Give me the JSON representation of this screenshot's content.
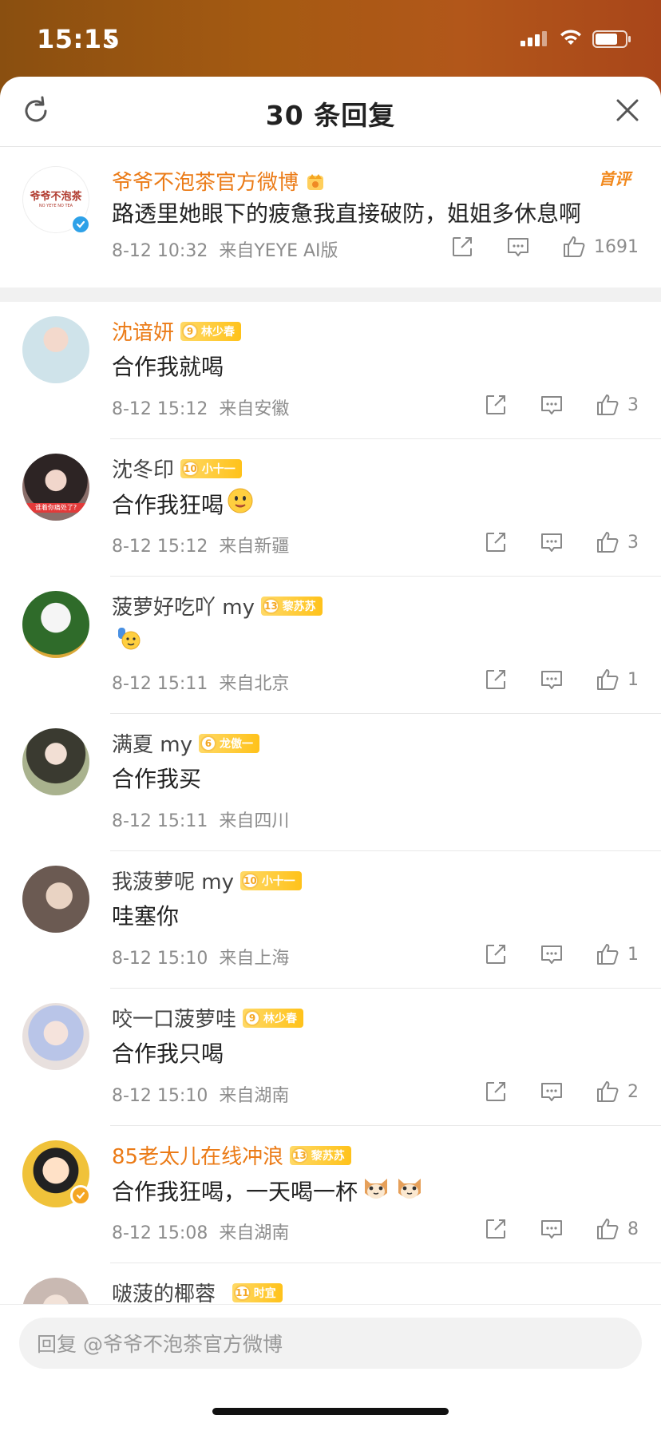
{
  "status_bar": {
    "time": "15:15"
  },
  "header": {
    "title": "30 条回复"
  },
  "root_comment": {
    "user": "爷爷不泡茶官方微博",
    "avatar_brand_text": "爷爷不泡茶",
    "avatar_brand_sub": "NO YEYE NO TEA",
    "text": "路透里她眼下的疲惫我直接破防，姐姐多休息啊",
    "time": "8-12 10:32",
    "source": "来自YEYE AI版",
    "likes": "1691",
    "first_badge": "首评",
    "verified": true
  },
  "replies": [
    {
      "user": "沈谙妍",
      "name_color": "orange",
      "fan_level": "9",
      "fan_name": "林少春",
      "text": "合作我就喝",
      "emojis": [],
      "time": "8-12 15:12",
      "source": "来自安徽",
      "likes": "3",
      "show_actions": true
    },
    {
      "user": "沈冬印",
      "name_color": "gray",
      "fan_level": "10",
      "fan_name": "小十一",
      "text": "合作我狂喝",
      "emojis": [
        "drool-face-emoji"
      ],
      "time": "8-12 15:12",
      "source": "来自新疆",
      "likes": "3",
      "show_actions": true,
      "avatar_caption": "谁着你痛处了?"
    },
    {
      "user": "菠萝好吃吖 my",
      "name_color": "gray",
      "fan_level": "13",
      "fan_name": "黎苏苏",
      "text": "",
      "emojis": [
        "raise-hand-emoji"
      ],
      "time": "8-12 15:11",
      "source": "来自北京",
      "likes": "1",
      "show_actions": true
    },
    {
      "user": "满夏 my",
      "name_color": "gray",
      "fan_level": "6",
      "fan_name": "龙傲一",
      "text": "合作我买",
      "emojis": [],
      "time": "8-12 15:11",
      "source": "来自四川",
      "likes": "",
      "show_actions": false
    },
    {
      "user": "我菠萝呢 my",
      "name_color": "gray",
      "fan_level": "10",
      "fan_name": "小十一",
      "text": "哇塞你",
      "emojis": [],
      "time": "8-12 15:10",
      "source": "来自上海",
      "likes": "1",
      "show_actions": true
    },
    {
      "user": "咬一口菠萝哇",
      "name_color": "gray",
      "fan_level": "9",
      "fan_name": "林少春",
      "text": "合作我只喝",
      "emojis": [],
      "time": "8-12 15:10",
      "source": "来自湖南",
      "likes": "2",
      "show_actions": true
    },
    {
      "user": "85老太儿在线冲浪",
      "name_color": "orange",
      "fan_level": "13",
      "fan_name": "黎苏苏",
      "text": "合作我狂喝，一天喝一杯",
      "emojis": [
        "cat-face-emoji",
        "cat-face-emoji"
      ],
      "time": "8-12 15:08",
      "source": "来自湖南",
      "likes": "8",
      "show_actions": true,
      "verified": true
    },
    {
      "user": "啵菠的椰蓉_",
      "name_color": "gray",
      "fan_level": "11",
      "fan_name": "时宜",
      "text": "",
      "emojis": [],
      "time": "",
      "source": "",
      "likes": "",
      "show_actions": false
    }
  ],
  "reply_bar": {
    "placeholder": "回复 @爷爷不泡茶官方微博"
  },
  "colors": {
    "accent_orange": "#eb7b17",
    "badge_yellow": "#ffc21a",
    "verified_blue": "#2ea1e8",
    "verified_gold": "#f5a623"
  }
}
